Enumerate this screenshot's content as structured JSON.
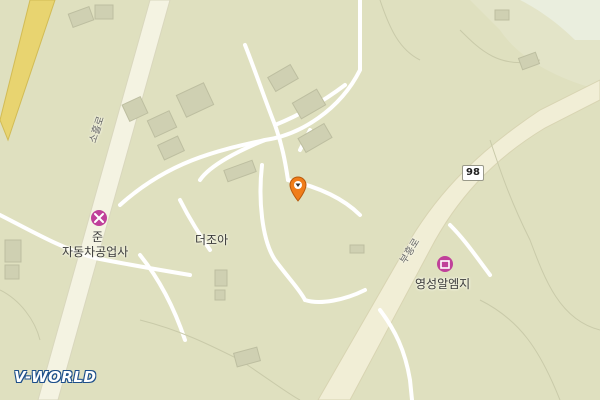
{
  "map": {
    "background_color": "#dfe0bf",
    "road_color": "#ffffff",
    "highway_color": "#e8d470",
    "building_color": "#cfd0b2"
  },
  "labels": {
    "poi_jun": "준",
    "poi_auto": "자동차공업사",
    "place_dejoa": "더조아",
    "poi_yeongseong": "영성알엠지",
    "road_left": "소흘로",
    "road_right": "부흥로"
  },
  "route_shield": {
    "number": "98"
  },
  "marker": {
    "icon": "location-pin-icon",
    "color": "#f07d1a"
  },
  "branding": {
    "logo_text": "V-WORLD"
  }
}
